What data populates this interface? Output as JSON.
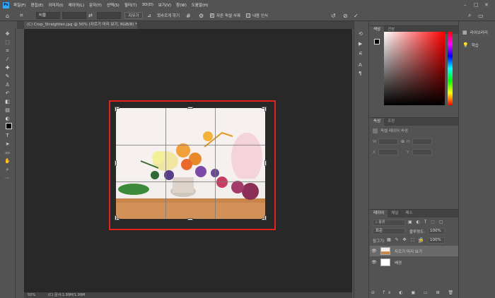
{
  "app": {
    "logo": "Ps",
    "menu": [
      "파일(F)",
      "편집(E)",
      "이미지(I)",
      "레이어(L)",
      "문자(Y)",
      "선택(S)",
      "필터(T)",
      "3D(D)",
      "보기(V)",
      "창(W)",
      "도움말(H)"
    ]
  },
  "options_bar": {
    "ratio_select": "비율",
    "clear_button": "지우기",
    "straighten_label": "똑바르게 하기",
    "delete_pixels_label": "자른 픽셀 삭제",
    "content_aware_label": "내용 인식",
    "delete_pixels_checked": true,
    "content_aware_checked": false
  },
  "document": {
    "tab_title": "(C) Crop_Straighten.jpg @ 50% (자르기 미리 보기, RGB/8) *",
    "zoom": "50%",
    "status_info": "(C) 문서:1.99M/1.99M"
  },
  "panels": {
    "color_tabs": [
      "색상",
      "견본"
    ],
    "properties_tabs": [
      "속성",
      "조정"
    ],
    "properties_subtitle": "픽셀 레이어 속성",
    "transform_fields": [
      "W",
      "H",
      "X",
      "Y"
    ],
    "layers_tabs": [
      "레이어",
      "채널",
      "패스"
    ],
    "layers_search": "종류",
    "blend_mode": "표준",
    "opacity_label": "불투명도:",
    "opacity_value": "100%",
    "lock_label": "잠그기:",
    "fill_label": "칠:",
    "fill_value": "100%",
    "layers": [
      {
        "name": "자르기 미리 보기",
        "selected": true
      },
      {
        "name": "배경",
        "selected": false
      }
    ]
  },
  "right_column": {
    "items": [
      "라이브러리",
      "학습"
    ]
  },
  "colors": {
    "crop_border": "#e3221a",
    "accent": "#31a8ff"
  }
}
